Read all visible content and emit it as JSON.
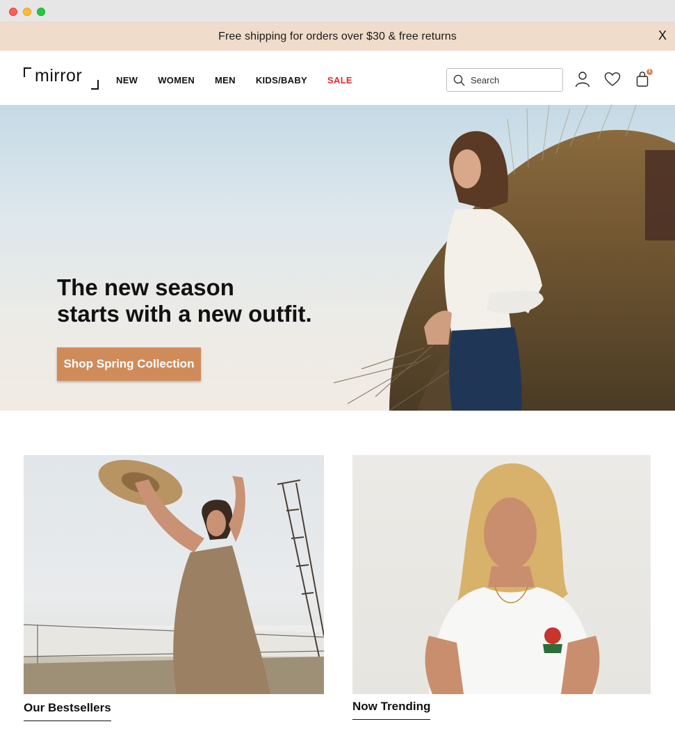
{
  "window": {
    "controls": [
      "close",
      "minimize",
      "maximize"
    ]
  },
  "promo": {
    "text": "Free shipping  for orders over $30 & free returns",
    "close_label": "X",
    "background": "#efdccb"
  },
  "header": {
    "logo_text": "mirror",
    "nav": [
      {
        "label": "NEW"
      },
      {
        "label": "WOMEN"
      },
      {
        "label": "MEN"
      },
      {
        "label": "KIDS/BABY"
      },
      {
        "label": "SALE",
        "color": "#e02a2a"
      }
    ],
    "search": {
      "placeholder": "Search",
      "value": "",
      "icon": "search-icon"
    },
    "icons": [
      "account-icon",
      "heart-icon",
      "cart-icon"
    ],
    "cart_badge": "1"
  },
  "hero": {
    "headline_line1": "The new season",
    "headline_line2": "starts with a new outfit.",
    "cta_label": "Shop Spring Collection",
    "accent": "#d08b5b"
  },
  "tiles": [
    {
      "label": "Our Bestsellers"
    },
    {
      "label": "Now Trending"
    }
  ]
}
